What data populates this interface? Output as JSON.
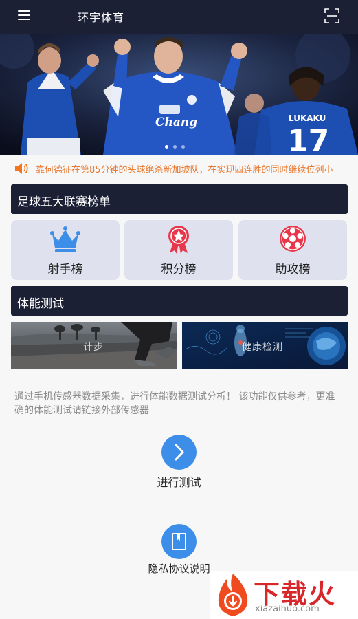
{
  "header": {
    "title": "环宇体育",
    "menu_icon": "menu-icon",
    "scan_icon": "scan-icon"
  },
  "banner": {
    "image": "football-players-celebrating",
    "slides": 3,
    "active_slide": 0,
    "jersey_text": "Chang",
    "jersey_number": "17",
    "jersey_name": "LUKAKU"
  },
  "notice": {
    "icon": "speaker-icon",
    "text": "靠何德征在第85分钟的头球绝杀新加坡队，在实现四连胜的同时继续位列小"
  },
  "leagues": {
    "section_title": "足球五大联赛榜单",
    "items": [
      {
        "label": "射手榜",
        "icon": "crown-icon",
        "color": "#3d8ee8"
      },
      {
        "label": "积分榜",
        "icon": "medal-icon",
        "color": "#e8374a"
      },
      {
        "label": "助攻榜",
        "icon": "soccer-ball-icon",
        "color": "#e8374a"
      }
    ]
  },
  "fitness": {
    "section_title": "体能测试",
    "cards": [
      {
        "label": "计步"
      },
      {
        "label": "健康检测"
      }
    ],
    "description": "通过手机传感器数据采集，进行体能数据测试分析！ 该功能仅供参考，更准确的体能测试请链接外部传感器"
  },
  "actions": {
    "start_test": {
      "label": "进行测试",
      "icon": "chevron-right-icon"
    },
    "privacy": {
      "label": "隐私协议说明",
      "icon": "book-icon"
    }
  },
  "watermark": {
    "main": "下载火",
    "sub": "xiazaihuo.com"
  },
  "colors": {
    "header_bg": "#1b2035",
    "notice_text": "#e8772e",
    "card_bg": "#dfe1ee",
    "accent_blue": "#3d8ee8"
  }
}
